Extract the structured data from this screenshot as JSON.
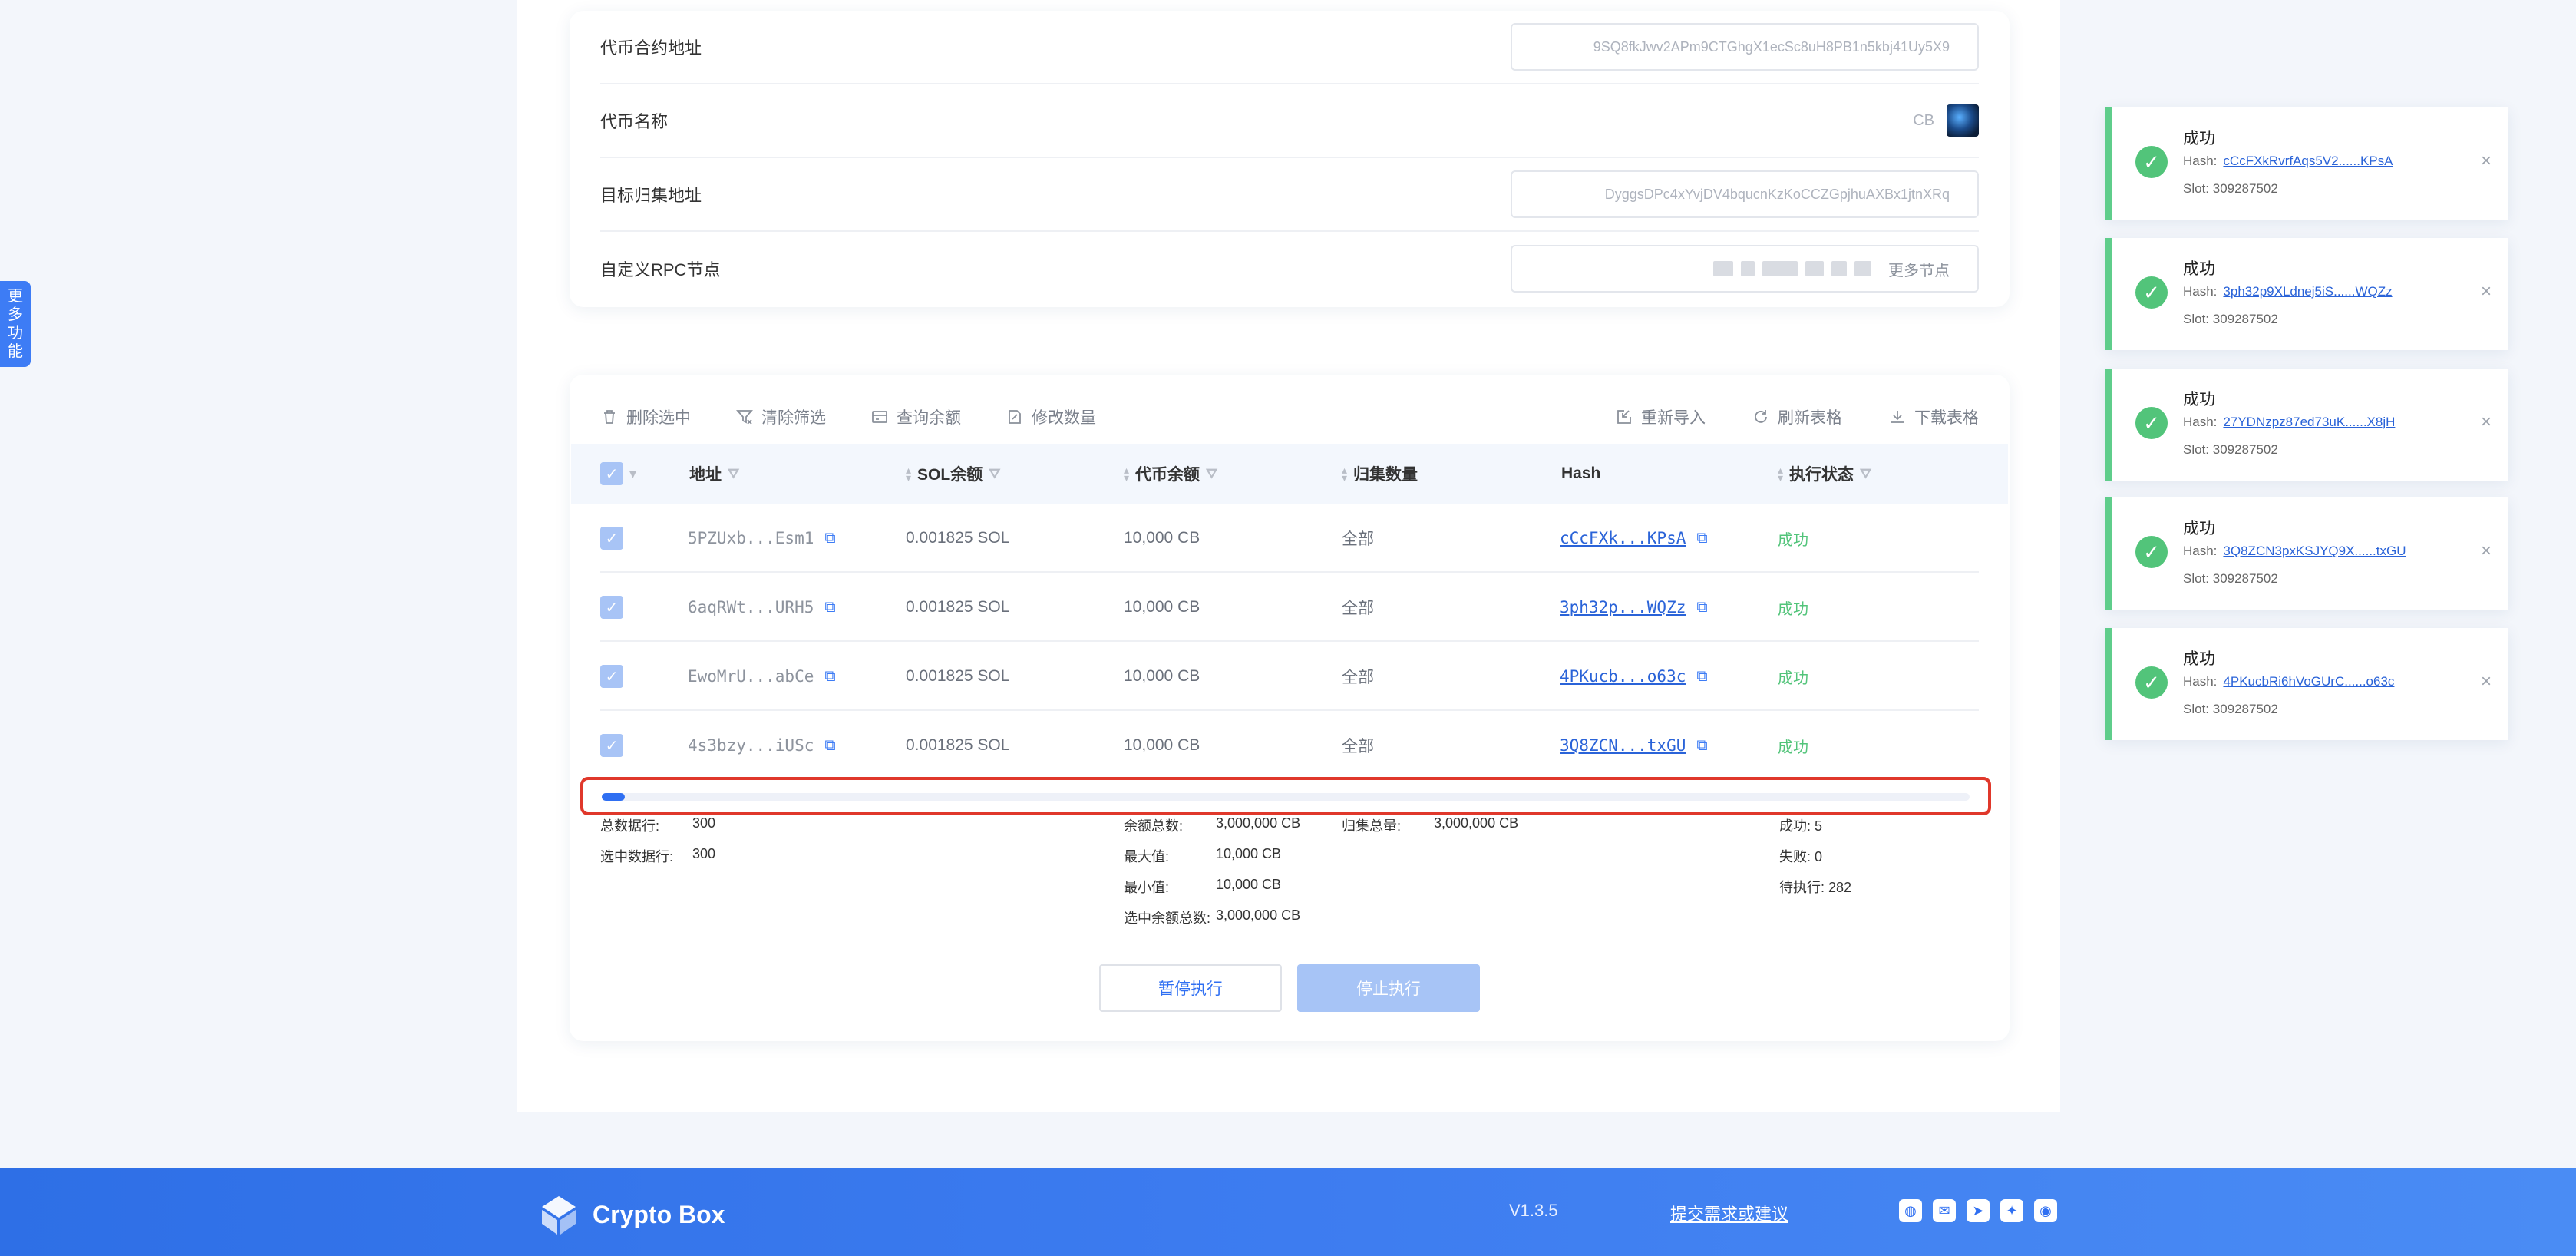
{
  "side_tab": {
    "chars": [
      "更",
      "多",
      "功",
      "能"
    ]
  },
  "config": {
    "contract_label": "代币合约地址",
    "contract_value": "9SQ8fkJwv2APm9CTGhgX1ecSc8uH8PB1n5kbj41Uy5X9",
    "token_name_label": "代币名称",
    "token_name_value": "CB",
    "target_label": "目标归集地址",
    "target_value": "DyggsDPc4xYvjDV4bqucnKzKoCCZGpjhuAXBx1jtnXRq",
    "rpc_label": "自定义RPC节点",
    "rpc_more": "更多节点"
  },
  "toolbar": {
    "delete_selected": "删除选中",
    "clear_filter": "清除筛选",
    "query_balance": "查询余额",
    "modify_amount": "修改数量",
    "reimport": "重新导入",
    "refresh_table": "刷新表格",
    "download_table": "下载表格"
  },
  "table": {
    "headers": {
      "address": "地址",
      "sol_balance": "SOL余额",
      "token_balance": "代币余额",
      "collect_amount": "归集数量",
      "hash": "Hash",
      "status": "执行状态"
    },
    "rows": [
      {
        "address": "5PZUxb...Esm1",
        "sol": "0.001825 SOL",
        "token": "10,000 CB",
        "amount": "全部",
        "hash": "cCcFXk...KPsA",
        "status": "成功"
      },
      {
        "address": "6aqRWt...URH5",
        "sol": "0.001825 SOL",
        "token": "10,000 CB",
        "amount": "全部",
        "hash": "3ph32p...WQZz",
        "status": "成功"
      },
      {
        "address": "EwoMrU...abCe",
        "sol": "0.001825 SOL",
        "token": "10,000 CB",
        "amount": "全部",
        "hash": "4PKucb...o63c",
        "status": "成功"
      },
      {
        "address": "4s3bzy...iUSc",
        "sol": "0.001825 SOL",
        "token": "10,000 CB",
        "amount": "全部",
        "hash": "3Q8ZCN...txGU",
        "status": "成功"
      }
    ]
  },
  "progress": {
    "fraction": 0.0167
  },
  "stats": {
    "total_rows_label": "总数据行:",
    "total_rows": "300",
    "selected_rows_label": "选中数据行:",
    "selected_rows": "300",
    "balance_total_label": "余额总数:",
    "balance_total": "3,000,000 CB",
    "max_label": "最大值:",
    "max": "10,000 CB",
    "min_label": "最小值:",
    "min": "10,000 CB",
    "selected_balance_label": "选中余额总数:",
    "selected_balance": "3,000,000 CB",
    "collect_total_label": "归集总量:",
    "collect_total": "3,000,000 CB",
    "success": "成功: 5",
    "fail": "失败: 0",
    "pending": "待执行: 282"
  },
  "buttons": {
    "pause": "暂停执行",
    "stop": "停止执行"
  },
  "toasts": [
    {
      "title": "成功",
      "hash_label": "Hash:",
      "hash": "cCcFXkRvrfAqs5V2......KPsA",
      "slot": "Slot: 309287502"
    },
    {
      "title": "成功",
      "hash_label": "Hash:",
      "hash": "3ph32p9XLdnej5iS......WQZz",
      "slot": "Slot: 309287502"
    },
    {
      "title": "成功",
      "hash_label": "Hash:",
      "hash": "27YDNzpz87ed73uK......X8jH",
      "slot": "Slot: 309287502"
    },
    {
      "title": "成功",
      "hash_label": "Hash:",
      "hash": "3Q8ZCN3pxKSJYQ9X......txGU",
      "slot": "Slot: 309287502"
    },
    {
      "title": "成功",
      "hash_label": "Hash:",
      "hash": "4PKucbRi6hVoGUrC......o63c",
      "slot": "Slot: 309287502"
    }
  ],
  "footer": {
    "brand": "Crypto Box",
    "version": "V1.3.5",
    "feedback": "提交需求或建议"
  },
  "colors": {
    "accent": "#2f6ff2",
    "success": "#52c47a",
    "highlight": "#e0382b"
  }
}
